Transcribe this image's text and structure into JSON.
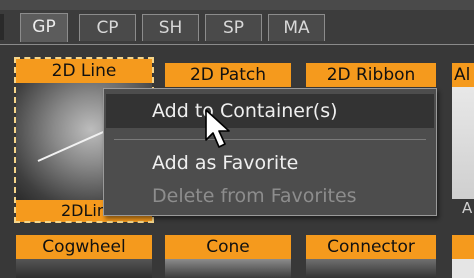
{
  "tabs": [
    {
      "label": "GP",
      "active": true
    },
    {
      "label": "CP"
    },
    {
      "label": "SH"
    },
    {
      "label": "SP"
    },
    {
      "label": "MA"
    }
  ],
  "palette": {
    "row1": {
      "line2d": {
        "label": "2D Line",
        "caption": "2DLin"
      },
      "patch2d": {
        "label": "2D Patch"
      },
      "ribbon2d": {
        "label": "2D Ribbon"
      },
      "partial": {
        "label": "Al",
        "caption": "A"
      }
    },
    "row2": {
      "cogwheel": {
        "label": "Cogwheel"
      },
      "cone": {
        "label": "Cone"
      },
      "connector": {
        "label": "Connector"
      }
    }
  },
  "context_menu": {
    "add_to_container": "Add to Container(s)",
    "add_favorite": "Add as Favorite",
    "delete_favorite": "Delete from Favorites"
  },
  "colors": {
    "accent": "#f59a1d",
    "menu_bg": "#4d4d4d",
    "hover_bg": "#333333"
  },
  "icons": {
    "cursor": "arrow-pointer-icon"
  }
}
